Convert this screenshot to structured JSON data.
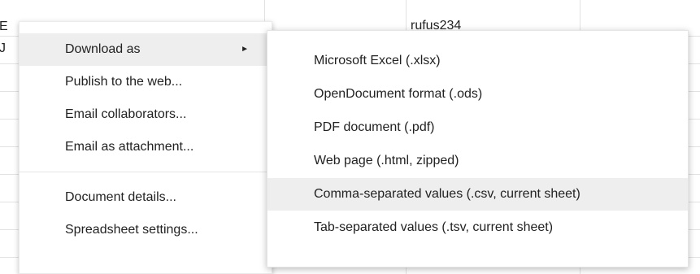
{
  "sheet": {
    "cells": {
      "a1_fragment": "E",
      "a2_fragment": "J",
      "c1_value": "rufus234"
    }
  },
  "file_menu": {
    "items": [
      {
        "label": "Download as",
        "has_submenu": true,
        "arrow": "►",
        "highlighted": true
      },
      {
        "label": "Publish to the web...",
        "has_submenu": false,
        "highlighted": false
      },
      {
        "label": "Email collaborators...",
        "has_submenu": false,
        "highlighted": false
      },
      {
        "label": "Email as attachment...",
        "has_submenu": false,
        "highlighted": false
      },
      {
        "label": "Document details...",
        "has_submenu": false,
        "highlighted": false
      },
      {
        "label": "Spreadsheet settings...",
        "has_submenu": false,
        "highlighted": false
      }
    ]
  },
  "download_submenu": {
    "items": [
      {
        "label": "Microsoft Excel (.xlsx)",
        "highlighted": false
      },
      {
        "label": "OpenDocument format (.ods)",
        "highlighted": false
      },
      {
        "label": "PDF document (.pdf)",
        "highlighted": false
      },
      {
        "label": "Web page (.html, zipped)",
        "highlighted": false
      },
      {
        "label": "Comma-separated values (.csv, current sheet)",
        "highlighted": true
      },
      {
        "label": "Tab-separated values (.tsv, current sheet)",
        "highlighted": false
      }
    ]
  },
  "colors": {
    "highlight_bg": "#eeeeee",
    "text": "#222222",
    "grid_line": "#e2e2e2",
    "menu_bg": "#ffffff"
  }
}
